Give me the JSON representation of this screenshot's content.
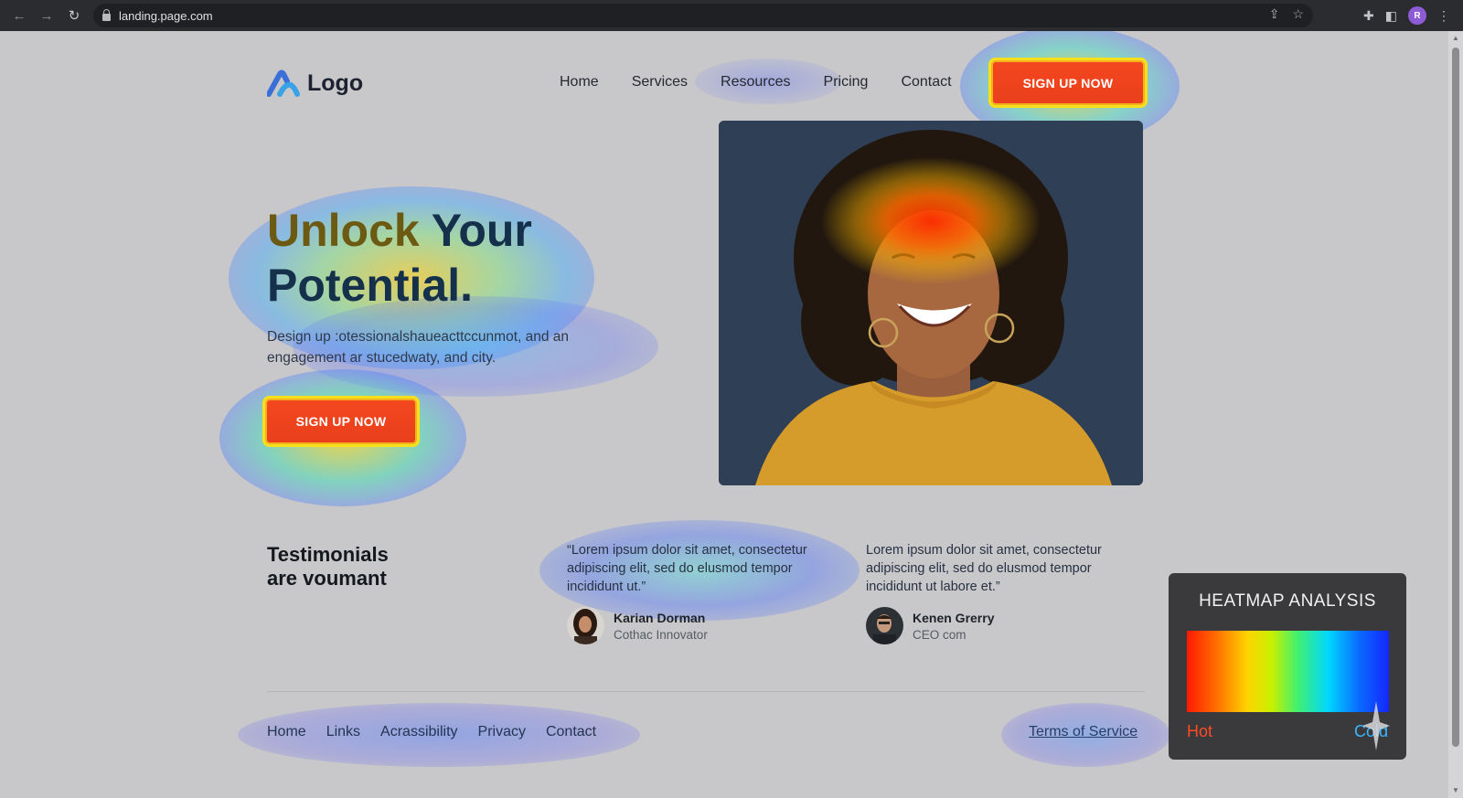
{
  "browser": {
    "url": "landing.page.com",
    "profile_initial": "R"
  },
  "header": {
    "logo_text": "Logo",
    "nav": [
      "Home",
      "Services",
      "Resources",
      "Pricing",
      "Contact"
    ],
    "cta_label": "SIGN UP NOW"
  },
  "hero": {
    "title_word1": "Unlock",
    "title_word2": "Your",
    "title_line2": "Potential.",
    "subtitle": "Design up :otessionalshaueacttccunmot, and an engagement ar stucedwaty, and city.",
    "cta_label": "SIGN UP NOW"
  },
  "testimonials": {
    "title_line1": "Testimonials",
    "title_line2": "are voumant",
    "items": [
      {
        "quote": "“Lorem ipsum dolor sit amet, consectetur adipiscing elit, sed do elusmod tempor incididunt ut.”",
        "name": "Karian Dorman",
        "role": "Cothac Innovator"
      },
      {
        "quote": "Lorem ipsum dolor sit amet, consectetur adipiscing elit, sed do elusmod tempor incididunt ut labore et.”",
        "name": "Kenen Grerry",
        "role": "CEO com"
      }
    ]
  },
  "footer": {
    "links": [
      "Home",
      "Links",
      "Acrassibility",
      "Privacy",
      "Contact"
    ],
    "terms": "Terms of Service"
  },
  "heatmap_panel": {
    "title": "HEATMAP ANALYSIS",
    "hot_label": "Hot",
    "cold_label": "Cold"
  },
  "colors": {
    "cta_red": "#e9421c",
    "title_navy": "#15304a",
    "panel_bg": "#3a3a3c"
  }
}
